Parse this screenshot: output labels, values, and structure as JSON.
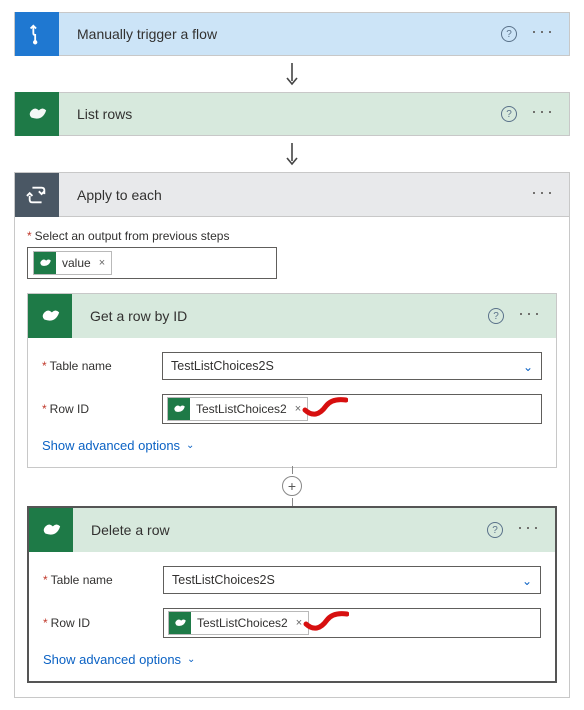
{
  "trigger": {
    "title": "Manually trigger a flow"
  },
  "list_rows": {
    "title": "List rows"
  },
  "apply": {
    "title": "Apply to each",
    "select_label": "Select an output from previous steps",
    "token": "value"
  },
  "get_row": {
    "title": "Get a row by ID",
    "table_label": "Table name",
    "table_value": "TestListChoices2S",
    "rowid_label": "Row ID",
    "rowid_token": "TestListChoices2",
    "advanced": "Show advanced options"
  },
  "delete_row": {
    "title": "Delete a row",
    "table_label": "Table name",
    "table_value": "TestListChoices2S",
    "rowid_label": "Row ID",
    "rowid_token": "TestListChoices2",
    "advanced": "Show advanced options"
  },
  "icons": {
    "plus": "+",
    "more": "···"
  }
}
